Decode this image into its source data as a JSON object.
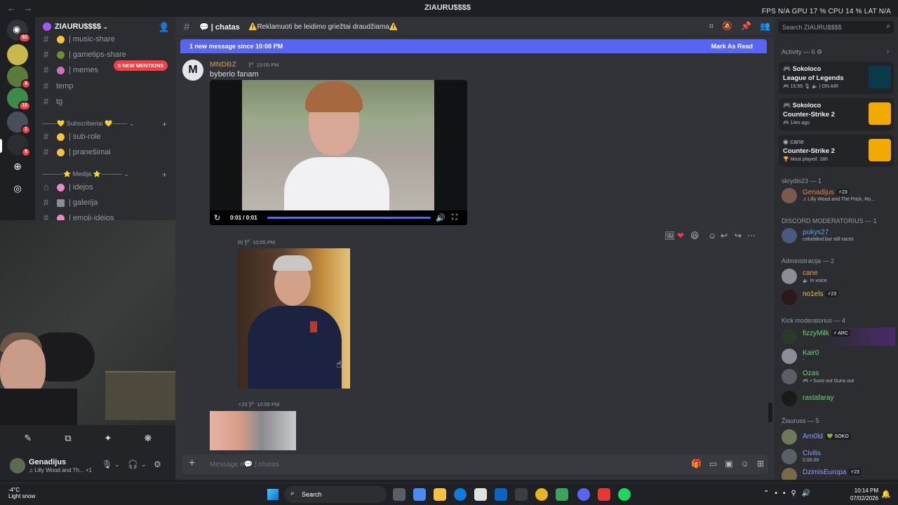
{
  "titlebar": {
    "back": "←",
    "forward": "→",
    "server_title": "ZIAURU$$$$",
    "stats": "FPS N/A   GPU 17 %   CPU 14 %   LAT N/A"
  },
  "rail": {
    "badges": [
      "92",
      "9",
      "10",
      "1",
      "5"
    ]
  },
  "guild": {
    "name": "ZIAURU$$$$"
  },
  "channels": {
    "mentions_pill": "5 NEW MENTIONS",
    "items": [
      {
        "label": "| music-share"
      },
      {
        "label": "| gametips-share"
      },
      {
        "label": "| memes"
      },
      {
        "label": "temp"
      },
      {
        "label": "tg"
      },
      {
        "label": "| sub-role"
      },
      {
        "label": "| pranešimai"
      },
      {
        "label": "| idejos"
      },
      {
        "label": "| galerija"
      },
      {
        "label": "| emoji-idėjos"
      }
    ],
    "categories": [
      {
        "label": "-------💛 Subscriberiai 💛------- ⌄"
      },
      {
        "label": "----------⭐ Medija ⭐---------- ⌄"
      }
    ]
  },
  "voice": {
    "cam_off_icon": "✎",
    "screen_icon": "⧉",
    "activities_icon": "✦",
    "soundboard_icon": "❋"
  },
  "user": {
    "name": "Genadijus",
    "status": "♫ Lilly Wood and Th...  +1"
  },
  "header": {
    "channel": "| chatas",
    "topic": "⚠️Reklamuoti be leidimo griežtai draudžiama⚠️",
    "search_placeholder": "Search ZIAURU$$$$"
  },
  "newmsg": {
    "text": "1 new message since 10:08 PM",
    "action": "Mark As Read"
  },
  "message": {
    "avatar_letter": "M",
    "author": "MNDBZ",
    "time": "10:05 PM",
    "text": "byberio fanam",
    "video_time": "0:01 / 0:01",
    "video_progress": 1.0
  },
  "messages2": [
    {
      "meta": "RI  🏴  10:05 PM"
    },
    {
      "meta": "⚡23  🏴  10:06 PM"
    }
  ],
  "composer": {
    "placeholder": "Message #💬 | chatas"
  },
  "activity": {
    "header": "Activity — 6 ⚙",
    "cards": [
      {
        "who": "Sokoloco",
        "game": "League of Legends",
        "meta": "🎮 15:56  🎙 🔈 | ON AIR",
        "color": "#c89b3c"
      },
      {
        "who": "Sokoloco",
        "game": "Counter-Strike 2",
        "meta": "🎮 14m ago",
        "color": "#f2a900"
      },
      {
        "who": "cane",
        "game": "Counter-Strike 2",
        "meta": "🏆 Most played: 18h",
        "color": "#f2a900"
      }
    ]
  },
  "members": {
    "sections": [
      "skrydis23 — 1",
      "DISCORD MODERATORIUS — 1",
      "Administracija — 2",
      "Kick moderatorius — 4",
      "Žiauruss — 5"
    ],
    "list": [
      {
        "name": "Genadijus",
        "tag": "⚡23",
        "status": "♫ Lilly Wood and The Prick, Ro...",
        "color": "#e8844a"
      },
      {
        "name": "pukys27",
        "tag": "",
        "status": "colorblind but still racist",
        "color": "#5ba3f5"
      },
      {
        "name": "cane",
        "tag": "",
        "status": "🔈 In voice",
        "color": "#e0a84a"
      },
      {
        "name": "no1els",
        "tag": "⚡23",
        "status": "",
        "color": "#e8c15a"
      },
      {
        "name": "fizzyMilk",
        "tag": "⚡ ARC",
        "status": "",
        "color": "#6ed47a"
      },
      {
        "name": "Kair0",
        "tag": "",
        "status": "-",
        "color": "#6ed47a"
      },
      {
        "name": "Ozas",
        "tag": "",
        "status": "🎮 • Suns out Guns out",
        "color": "#6ed47a"
      },
      {
        "name": "rastafaray",
        "tag": "",
        "status": "",
        "color": "#6ed47a"
      },
      {
        "name": "Arn0ld",
        "tag": "💚 SOKO",
        "status": "",
        "color": "#8b9cff"
      },
      {
        "name": "Civilis",
        "tag": "",
        "status": "0.00.00",
        "color": "#8b9cff"
      },
      {
        "name": "DzimisEuropa",
        "tag": "⚡23",
        "status": "",
        "color": "#8b9cff"
      }
    ]
  },
  "taskbar": {
    "temp": "-4°C",
    "weather": "Light snow",
    "search": "Search",
    "time": "10:14 PM",
    "date": "07/02/2026"
  }
}
